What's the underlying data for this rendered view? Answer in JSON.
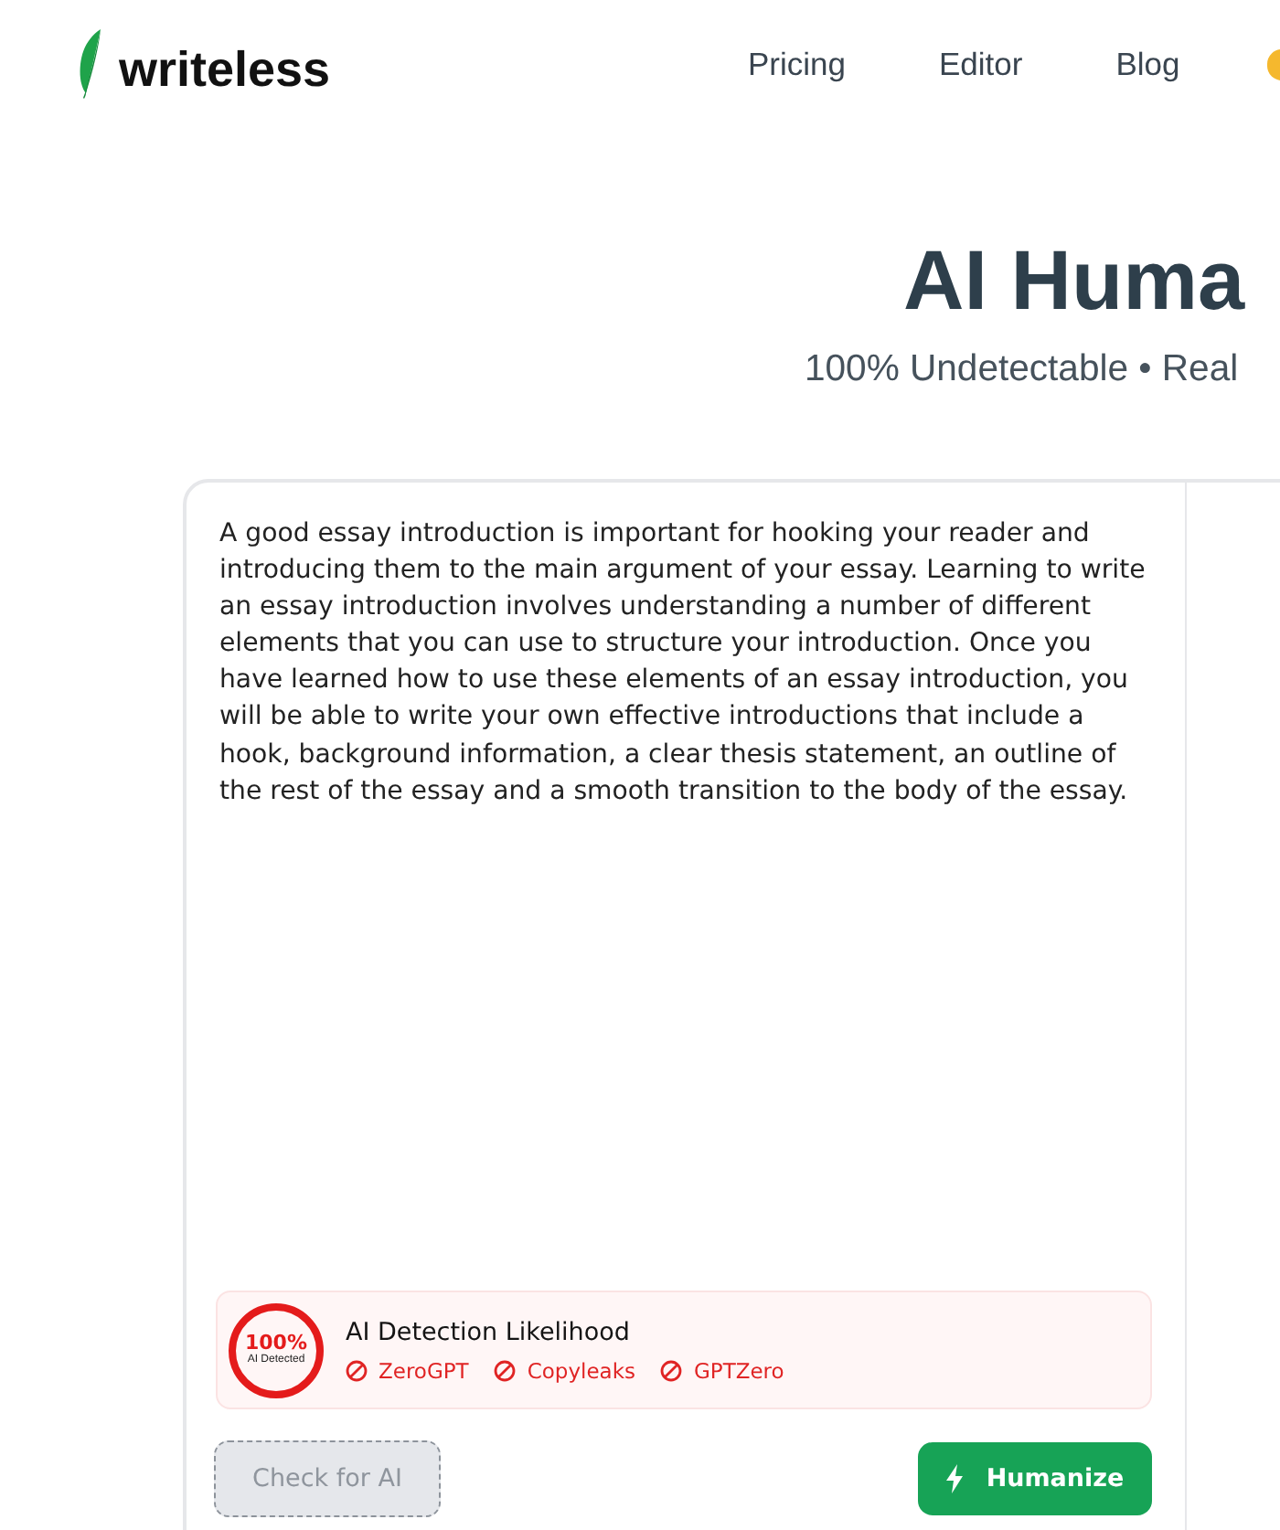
{
  "header": {
    "logo": "writeless",
    "nav": [
      {
        "label": "Pricing"
      },
      {
        "label": "Editor"
      },
      {
        "label": "Blog"
      }
    ]
  },
  "hero": {
    "title": "AI Huma",
    "subtitle": "100% Undetectable • Real"
  },
  "editor": {
    "input_text": "A good essay introduction is important for hooking your reader and introducing them to the main argument of your essay. Learning to write an essay introduction involves understanding a number of different elements that you can use to structure your introduction. Once you have learned how to use these elements of an essay introduction, you will be able to write your own effective introductions that include a hook, background information, a clear thesis statement, an outline of the rest of the essay and a smooth transition to the body of the essay.",
    "detection": {
      "score": "100%",
      "score_caption": "AI Detected",
      "title": "AI Detection Likelihood",
      "detectors": [
        {
          "name": "ZeroGPT"
        },
        {
          "name": "Copyleaks"
        },
        {
          "name": "GPTZero"
        }
      ]
    },
    "buttons": [
      {
        "label": "Check for AI",
        "kind": "secondary",
        "disabled": true
      },
      {
        "label": "Humanize",
        "kind": "primary",
        "disabled": false
      }
    ]
  }
}
